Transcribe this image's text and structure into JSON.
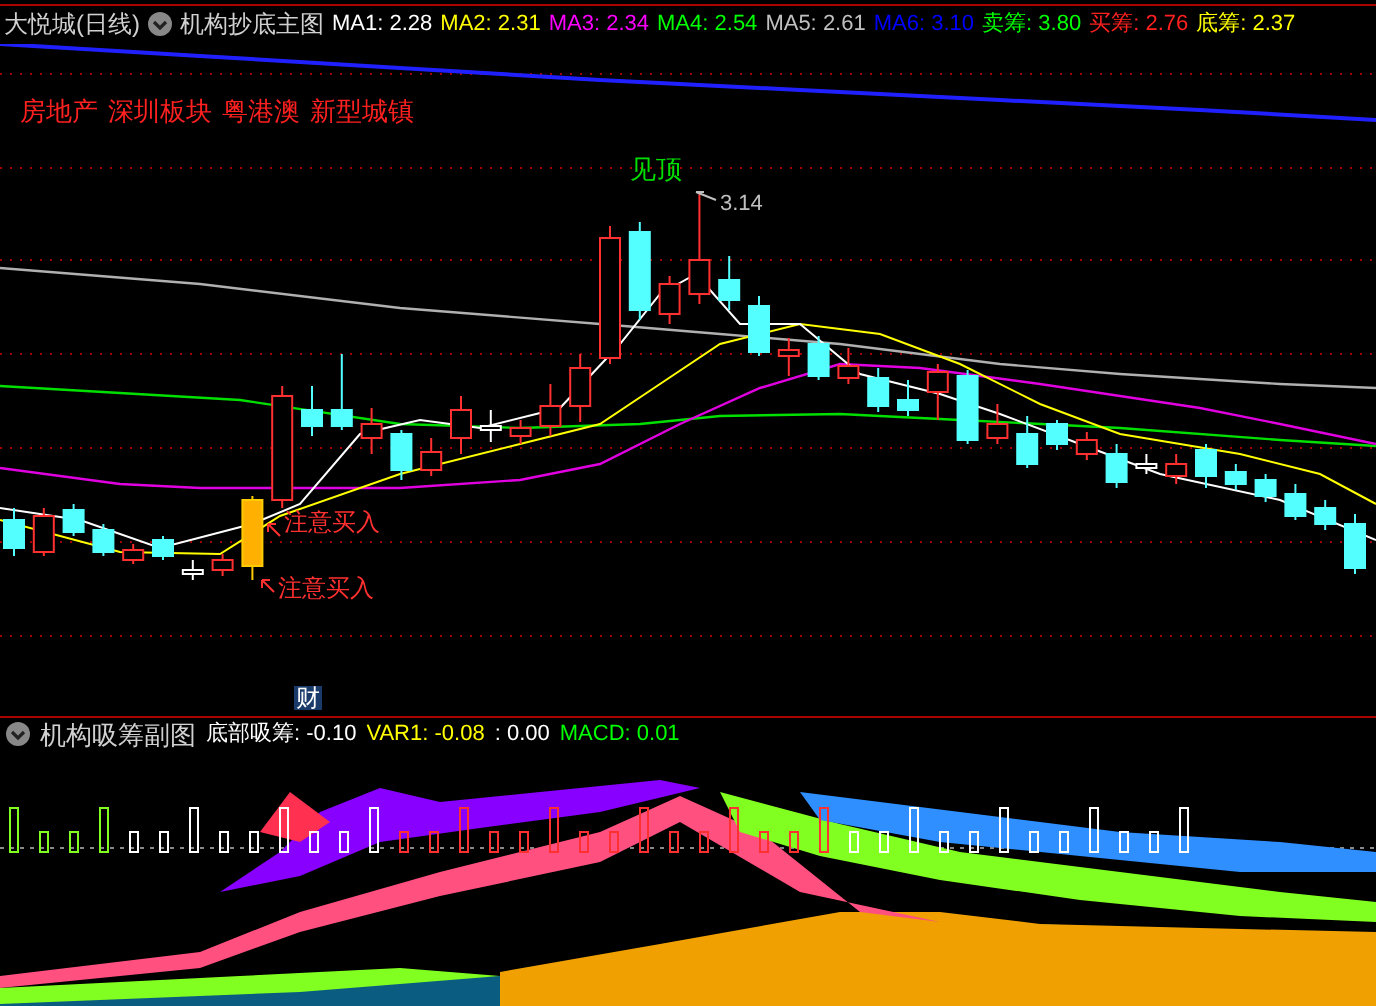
{
  "main_header": {
    "stock": "大悦城(日线)",
    "indicator": "机构抄底主图",
    "values": [
      {
        "label": "MA1:",
        "value": "2.28",
        "color": "#ffffff"
      },
      {
        "label": "MA2:",
        "value": "2.31",
        "color": "#ffff00"
      },
      {
        "label": "MA3:",
        "value": "2.34",
        "color": "#ff00ff"
      },
      {
        "label": "MA4:",
        "value": "2.54",
        "color": "#00ff00"
      },
      {
        "label": "MA5:",
        "value": "2.61",
        "color": "#c0c0c0"
      },
      {
        "label": "MA6:",
        "value": "3.10",
        "color": "#0000ff"
      },
      {
        "label": "卖筹:",
        "value": "3.80",
        "color": "#00ff00"
      },
      {
        "label": "买筹:",
        "value": "2.76",
        "color": "#ff2020"
      },
      {
        "label": "底筹:",
        "value": "2.37",
        "color": "#ffff00"
      }
    ]
  },
  "sector_tags": [
    "房地产",
    "深圳板块",
    "粤港澳",
    "新型城镇"
  ],
  "top_signal": "见顶",
  "high_price": "3.14",
  "buy_signals": [
    "注意买入",
    "注意买入"
  ],
  "finance_marker": "财",
  "sub_header": {
    "indicator": "机构吸筹副图",
    "values": [
      {
        "label": "底部吸筹:",
        "value": "-0.10",
        "color": "#ffffff"
      },
      {
        "label": "VAR1:",
        "value": "-0.08",
        "color": "#ffff00"
      },
      {
        "label": ":",
        "value": "0.00",
        "color": "#ffffff"
      },
      {
        "label": "MACD:",
        "value": "0.01",
        "color": "#00ff00"
      }
    ]
  }
}
